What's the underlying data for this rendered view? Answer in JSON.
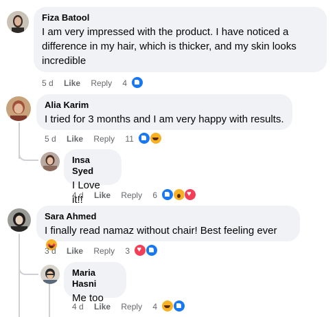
{
  "comments": [
    {
      "author": "Fiza Batool",
      "text": "I am very impressed with the product. I have noticed a difference in my hair, which is thicker, and my skin looks incredible",
      "time": "5 d",
      "like_label": "Like",
      "reply_label": "Reply",
      "reaction_count": "4",
      "reactions": [
        "like"
      ]
    },
    {
      "author": "Alia Karim",
      "text": "I tried for 3 months and I am very happy with results.",
      "time": "5 d",
      "like_label": "Like",
      "reply_label": "Reply",
      "reaction_count": "11",
      "reactions": [
        "like",
        "haha"
      ],
      "replies": [
        {
          "author": "Insa Syed",
          "text": "I Love it!!",
          "time": "4 d",
          "like_label": "Like",
          "reply_label": "Reply",
          "reaction_count": "6",
          "reactions": [
            "like",
            "wow",
            "love"
          ]
        }
      ]
    },
    {
      "author": "Sara Ahmed",
      "text": "I finally read namaz without chair! Best feeling ever",
      "text_emoji": "star-struck-emoji",
      "time": "3 d",
      "like_label": "Like",
      "reply_label": "Reply",
      "reaction_count": "3",
      "reactions": [
        "love",
        "like"
      ],
      "replies": [
        {
          "author": "Maria Hasni",
          "text": "Me too",
          "time": "4 d",
          "like_label": "Like",
          "reply_label": "Reply",
          "reaction_count": "4",
          "reactions": [
            "haha",
            "like"
          ]
        }
      ]
    }
  ],
  "colors": {
    "bubble": "#f0f2f5",
    "meta_text": "#65676b",
    "like_blue": "#1877f2",
    "love_red": "#f33e58",
    "emoji_yellow": "#f7b125",
    "thread_line": "#ced0d4"
  }
}
